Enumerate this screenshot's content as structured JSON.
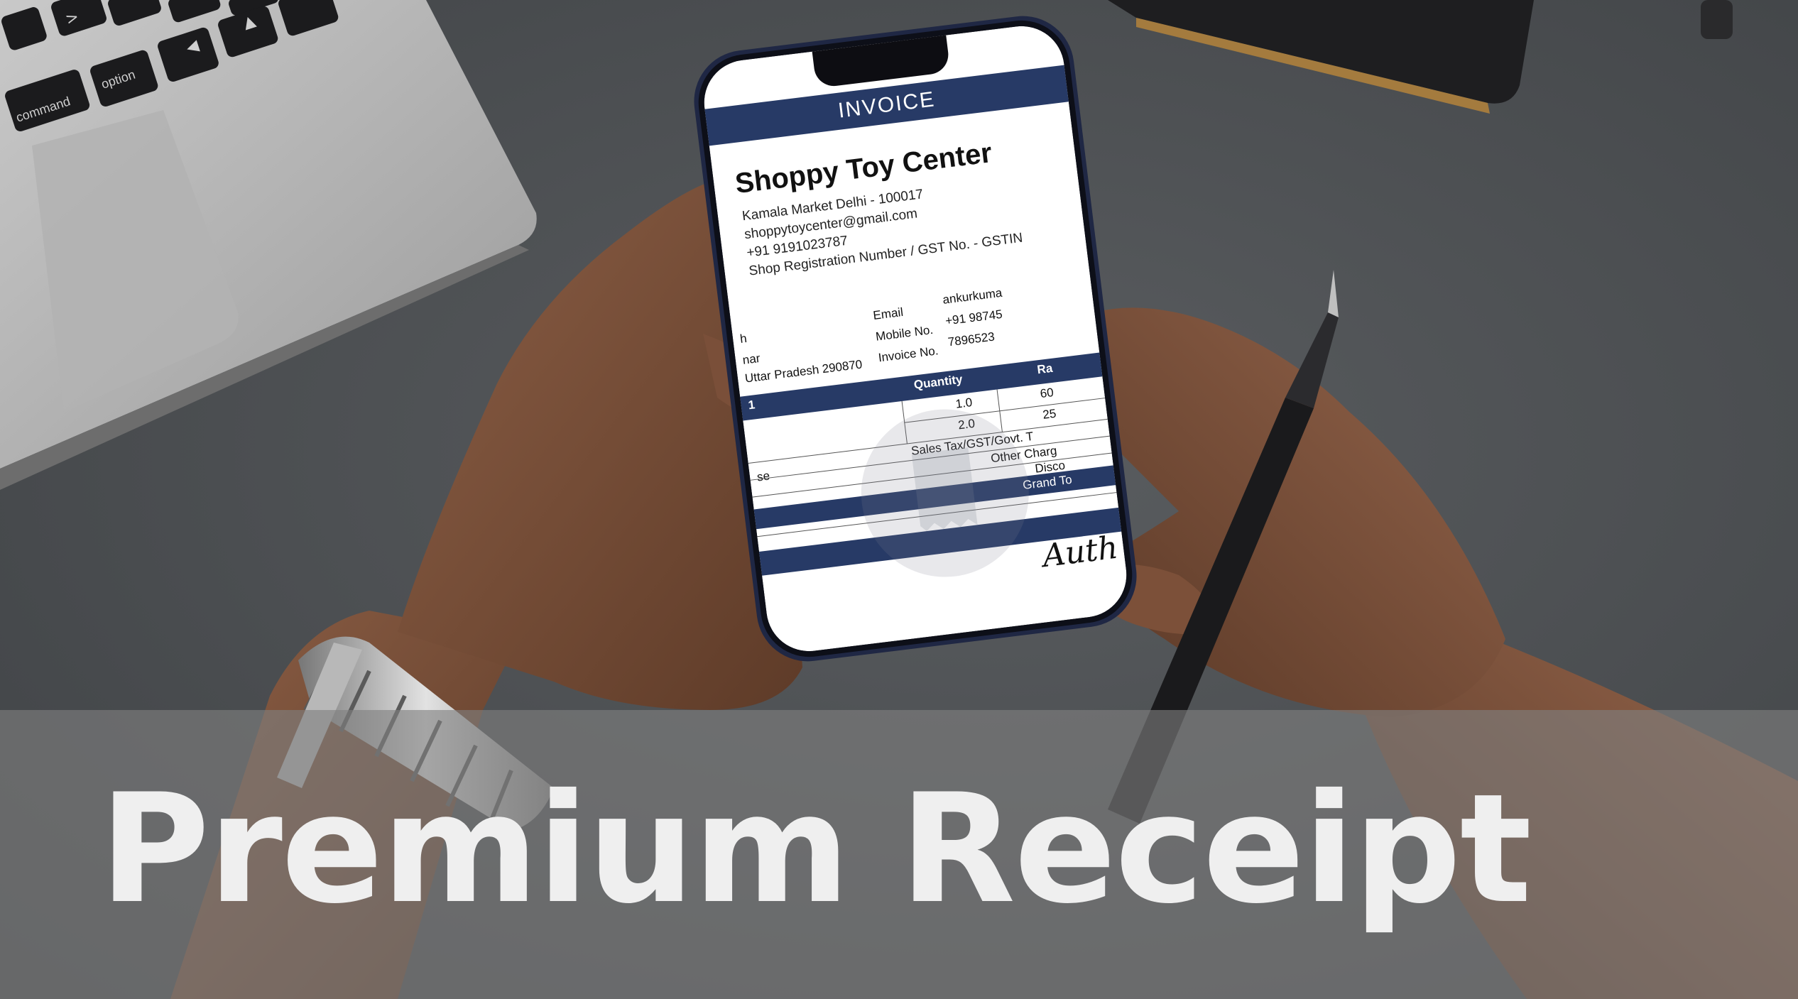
{
  "banner": {
    "title": "Premium Receipt"
  },
  "laptop_keys": {
    "command": "command",
    "option": "option"
  },
  "invoice": {
    "header": "INVOICE",
    "shop_name": "Shoppy Toy Center",
    "address": "Kamala Market Delhi - 100017",
    "email": "shoppytoycenter@gmail.com",
    "phone": "+91 9191023787",
    "registration": "Shop Registration Number / GST No. - GSTIN",
    "customer": {
      "line1": "h",
      "line2": "nar",
      "line3": "Uttar Pradesh 290870",
      "line4": "1"
    },
    "meta": {
      "email_label": "Email",
      "email_value": "ankurkuma",
      "mobile_label": "Mobile No.",
      "mobile_value": "+91 98745",
      "invoice_label": "Invoice No.",
      "invoice_value": "7896523"
    },
    "table": {
      "quantity_header": "Quantity",
      "rate_header": "Ra",
      "rows": [
        {
          "quantity": "1.0",
          "rate": "60"
        },
        {
          "quantity": "2.0",
          "rate": "25"
        }
      ]
    },
    "summary": {
      "left_fragment": "se",
      "sales_tax": "Sales Tax/GST/Govt. T",
      "other_charges": "Other Charg",
      "discount": "Disco",
      "grand_total": "Grand To"
    },
    "signature": "Auth"
  },
  "colors": {
    "invoice_navy": "#273a66",
    "desk": "#4f5255",
    "banner_text": "#efefef"
  }
}
